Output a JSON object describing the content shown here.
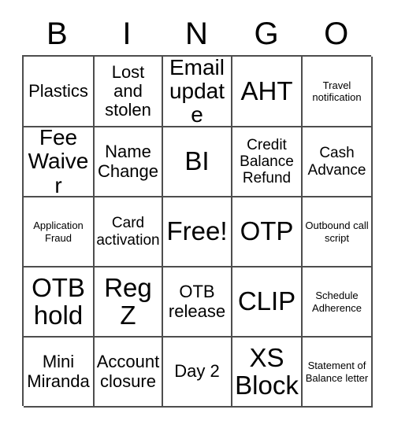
{
  "header": {
    "letters": [
      "B",
      "I",
      "N",
      "G",
      "O"
    ]
  },
  "grid": {
    "columns": 5,
    "rows": 5,
    "cells": [
      {
        "label": "Plastics",
        "size": "m"
      },
      {
        "label": "Lost and stolen",
        "size": "m"
      },
      {
        "label": "Email update",
        "size": "l"
      },
      {
        "label": "AHT",
        "size": "xl"
      },
      {
        "label": "Travel notification",
        "size": "xs"
      },
      {
        "label": "Fee Waiver",
        "size": "l"
      },
      {
        "label": "Name Change",
        "size": "m"
      },
      {
        "label": "BI",
        "size": "xl"
      },
      {
        "label": "Credit Balance Refund",
        "size": "s"
      },
      {
        "label": "Cash Advance",
        "size": "s"
      },
      {
        "label": "Application Fraud",
        "size": "xs"
      },
      {
        "label": "Card activation",
        "size": "s"
      },
      {
        "label": "Free!",
        "size": "xl"
      },
      {
        "label": "OTP",
        "size": "xl"
      },
      {
        "label": "Outbound call script",
        "size": "xs"
      },
      {
        "label": "OTB hold",
        "size": "xl"
      },
      {
        "label": "Reg Z",
        "size": "xl"
      },
      {
        "label": "OTB release",
        "size": "m"
      },
      {
        "label": "CLIP",
        "size": "xl"
      },
      {
        "label": "Schedule Adherence",
        "size": "xs"
      },
      {
        "label": "Mini Miranda",
        "size": "m"
      },
      {
        "label": "Account closure",
        "size": "m"
      },
      {
        "label": "Day 2",
        "size": "m"
      },
      {
        "label": "XS Block",
        "size": "xl"
      },
      {
        "label": "Statement of Balance letter",
        "size": "xs"
      }
    ]
  },
  "colors": {
    "border": "#4d4d4d",
    "text": "#000000",
    "background": "#ffffff"
  }
}
